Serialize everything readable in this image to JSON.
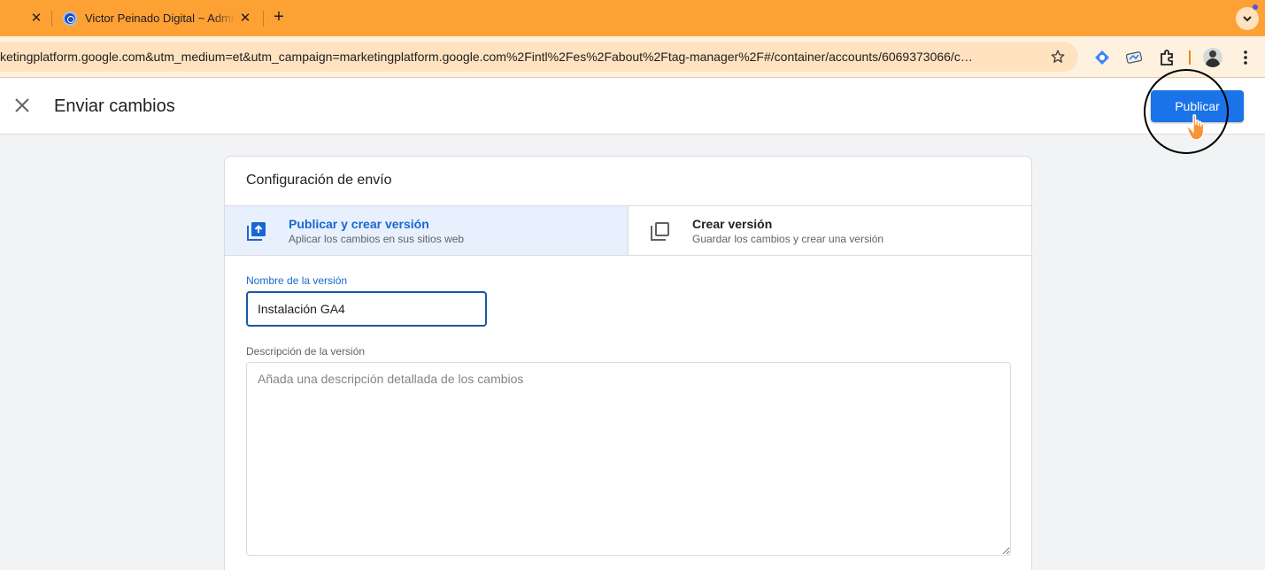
{
  "browser": {
    "tab_title": "Victor Peinado Digital ~ Admin",
    "url": "ketingplatform.google.com&utm_medium=et&utm_campaign=marketingplatform.google.com%2Fintl%2Fes%2Fabout%2Ftag-manager%2F#/container/accounts/6069373066/c…"
  },
  "header": {
    "title": "Enviar cambios",
    "publish_label": "Publicar"
  },
  "card": {
    "title": "Configuración de envío",
    "options": [
      {
        "title": "Publicar y crear versión",
        "subtitle": "Aplicar los cambios en sus sitios web",
        "selected": true
      },
      {
        "title": "Crear versión",
        "subtitle": "Guardar los cambios y crear una versión",
        "selected": false
      }
    ],
    "version_name_label": "Nombre de la versión",
    "version_name_value": "Instalación GA4",
    "version_desc_label": "Descripción de la versión",
    "version_desc_placeholder": "Añada una descripción detallada de los cambios"
  },
  "colors": {
    "tabbar": "#fea135",
    "accent": "#1a73e8",
    "selected_option_bg": "#e8f0fe"
  },
  "icons": [
    "close-icon",
    "site-favicon",
    "new-tab-icon",
    "star-icon",
    "extension-icon",
    "kebab-menu-icon",
    "publish-version-icon",
    "copy-version-icon",
    "hand-cursor-icon"
  ]
}
